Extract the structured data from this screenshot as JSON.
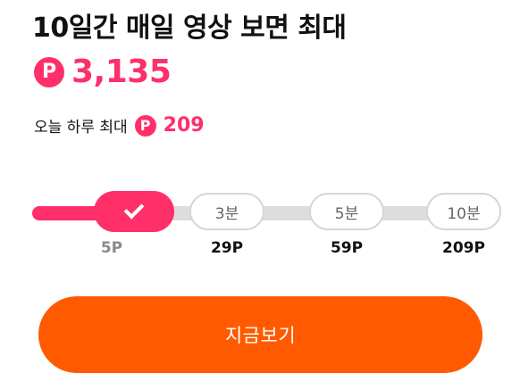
{
  "header": {
    "title": "10일간 매일 영상 보면 최대",
    "total_reward": "3,135"
  },
  "daily": {
    "label": "오늘 하루 최대",
    "amount": "209"
  },
  "point_icon": {
    "glyph": "P",
    "icon": "point-coin-icon",
    "color": "#ff2f6a"
  },
  "progress": {
    "steps": [
      {
        "label": "",
        "points": "5P",
        "completed": true
      },
      {
        "label": "3분",
        "points": "29P",
        "completed": false
      },
      {
        "label": "5분",
        "points": "59P",
        "completed": false
      },
      {
        "label": "10분",
        "points": "209P",
        "completed": false
      }
    ],
    "completed_steps": 1,
    "total_steps": 4
  },
  "cta": {
    "label": "지금보기",
    "color": "#ff5a00"
  }
}
